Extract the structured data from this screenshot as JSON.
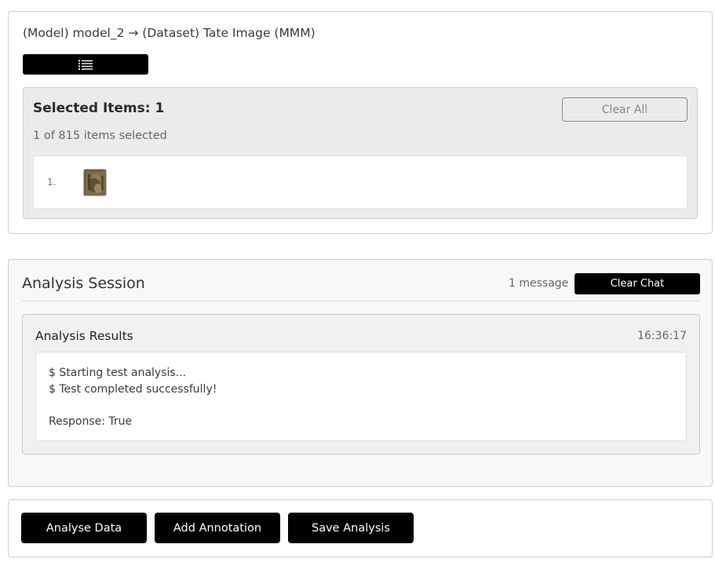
{
  "header": {
    "breadcrumb": "(Model) model_2 → (Dataset) Tate Image (MMM)",
    "menu_icon": "list-icon"
  },
  "selection": {
    "title": "Selected Items: 1",
    "count_text": "1 of 815 items selected",
    "clear_all_label": "Clear All",
    "items": [
      {
        "index": "1.",
        "thumbnail": "artwork-thumbnail"
      }
    ]
  },
  "session": {
    "title": "Analysis Session",
    "message_count": "1 message",
    "clear_chat_label": "Clear Chat",
    "result": {
      "title": "Analysis Results",
      "timestamp": "16:36:17",
      "lines": [
        "$ Starting test analysis...",
        "$ Test completed successfully!",
        "",
        "Response: True"
      ]
    }
  },
  "actions": {
    "analyse_label": "Analyse Data",
    "annotate_label": "Add Annotation",
    "save_label": "Save Analysis"
  },
  "colors": {
    "button_bg": "#000000",
    "panel_bg": "#ebebeb",
    "session_bg": "#f7f8f9"
  }
}
